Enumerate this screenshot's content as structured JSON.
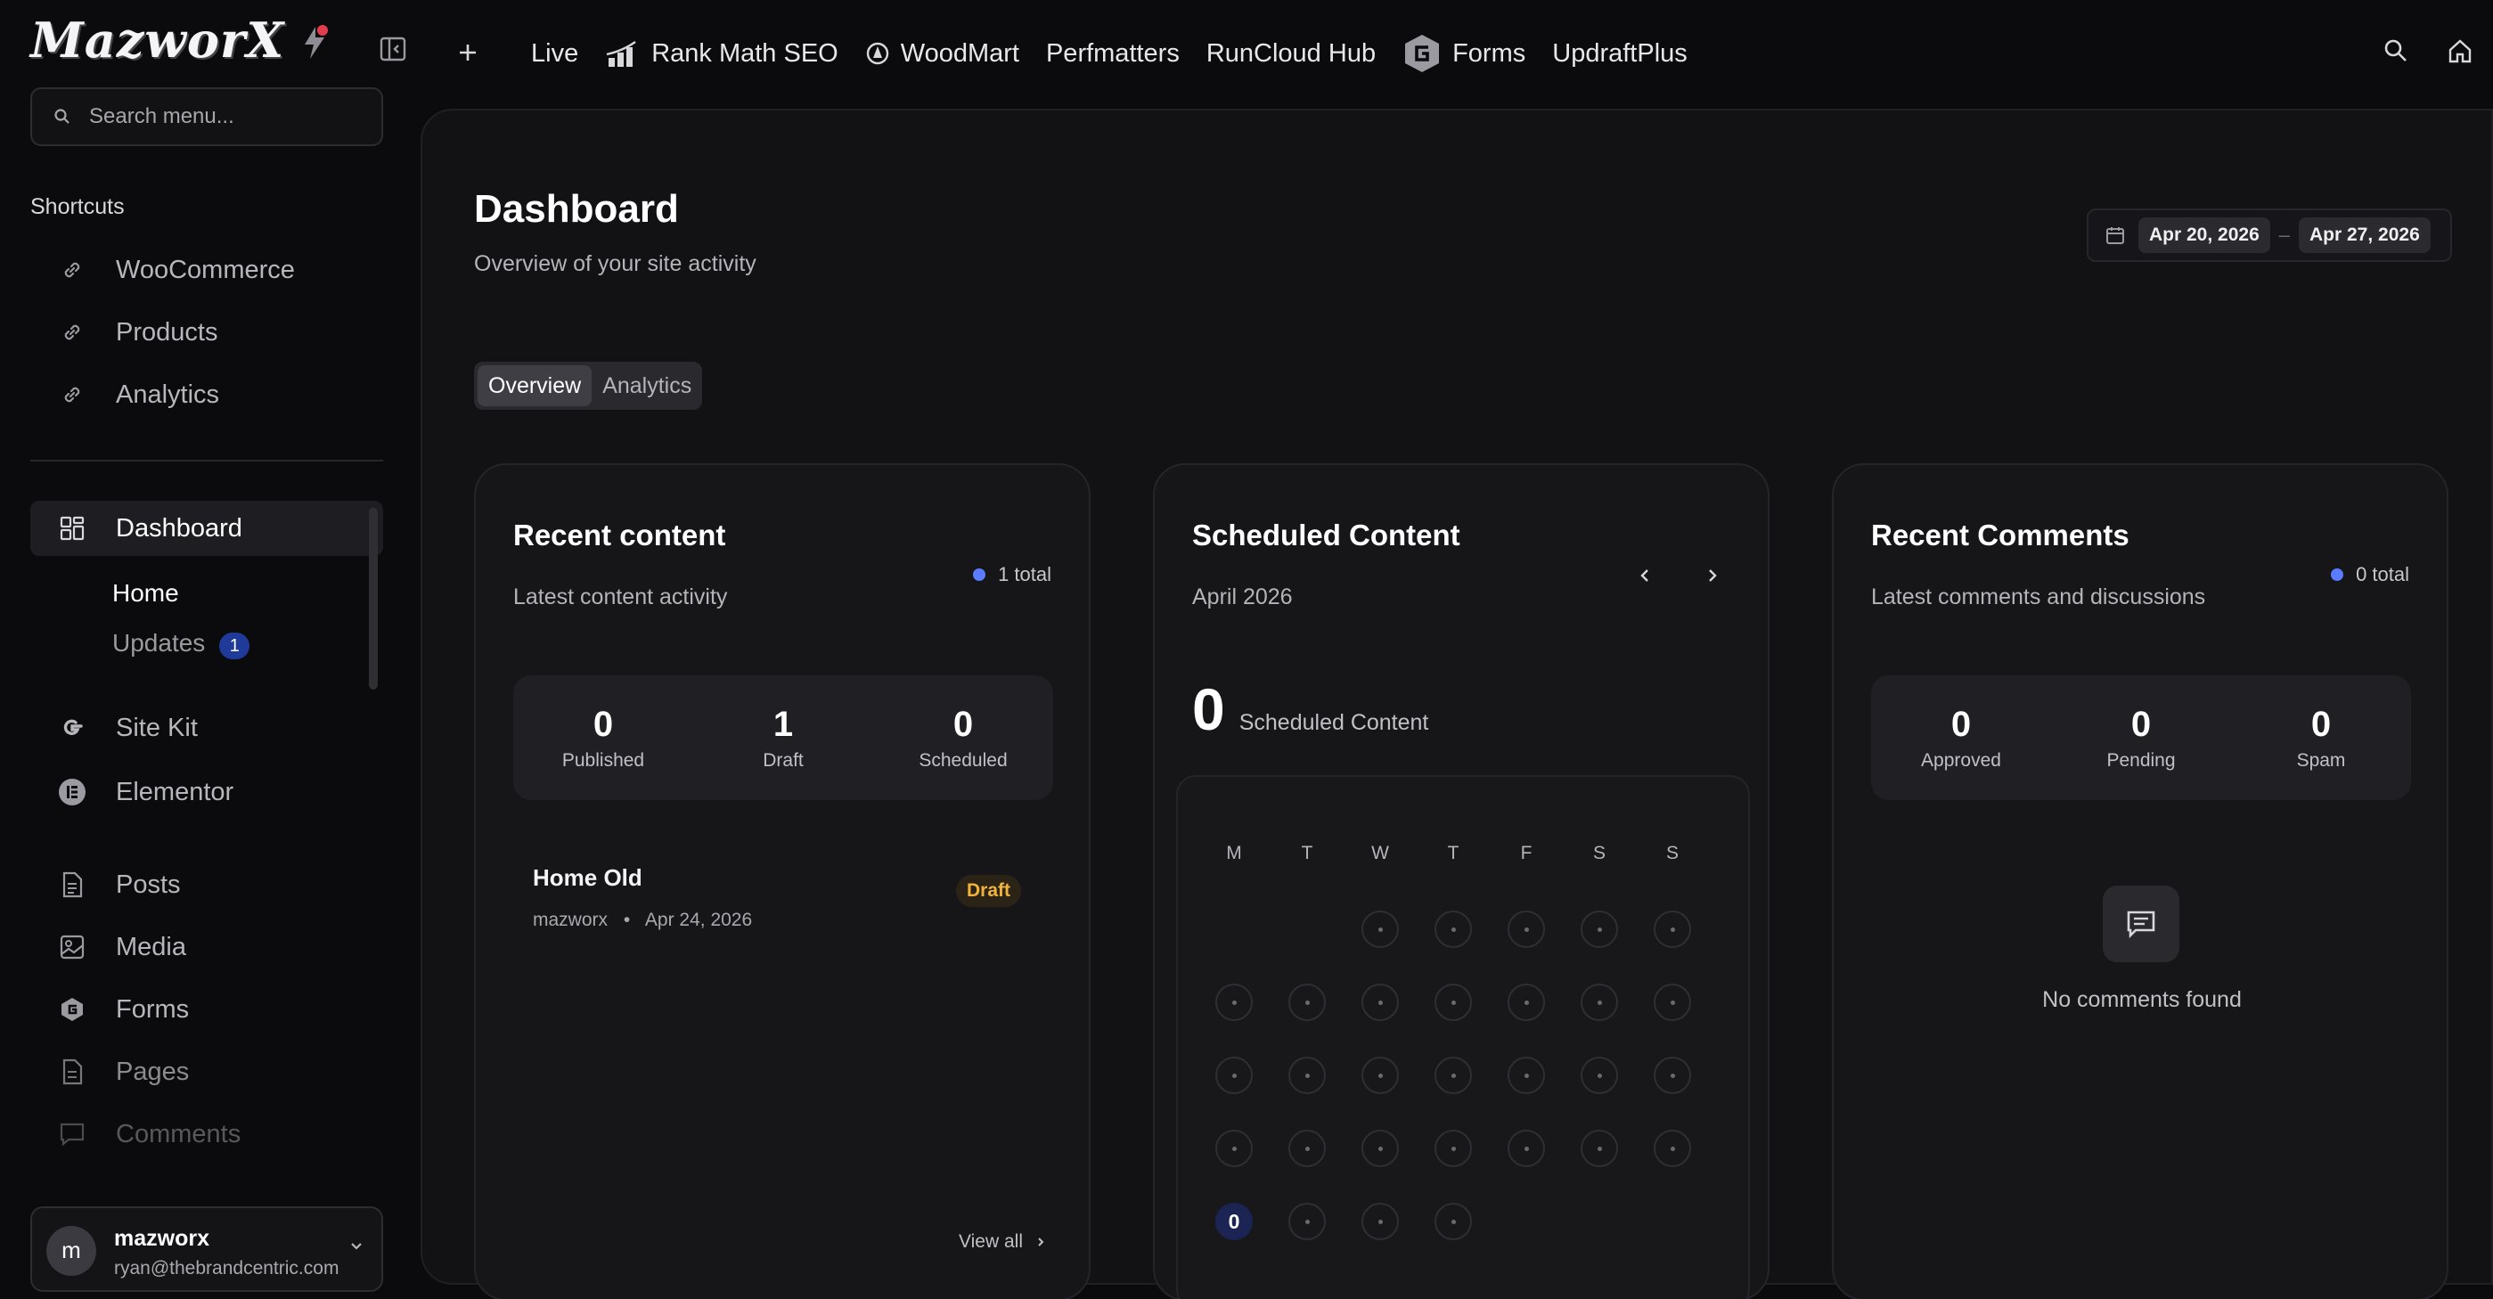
{
  "brand": {
    "logo_text": "MazworX"
  },
  "search": {
    "placeholder": "Search menu..."
  },
  "shortcuts": {
    "title": "Shortcuts",
    "items": [
      {
        "label": "WooCommerce",
        "icon": "link-icon"
      },
      {
        "label": "Products",
        "icon": "link-icon"
      },
      {
        "label": "Analytics",
        "icon": "link-icon"
      }
    ]
  },
  "sidebar": {
    "dashboard": {
      "label": "Dashboard",
      "icon": "grid-icon"
    },
    "home": "Home",
    "updates": {
      "label": "Updates",
      "count": "1"
    },
    "items": [
      {
        "label": "Site Kit",
        "icon": "google-icon"
      },
      {
        "label": "Elementor",
        "icon": "elementor-icon"
      },
      {
        "label": "Posts",
        "icon": "document-icon"
      },
      {
        "label": "Media",
        "icon": "image-icon"
      },
      {
        "label": "Forms",
        "icon": "forms-icon"
      },
      {
        "label": "Pages",
        "icon": "page-icon"
      },
      {
        "label": "Comments",
        "icon": "comment-icon"
      }
    ]
  },
  "user": {
    "initial": "m",
    "name": "mazworx",
    "email": "ryan@thebrandcentric.com"
  },
  "topnav": [
    "Live",
    "Rank Math SEO",
    "WoodMart",
    "Perfmatters",
    "RunCloud Hub",
    "Forms",
    "UpdraftPlus"
  ],
  "page": {
    "title": "Dashboard",
    "subtitle": "Overview of your site activity"
  },
  "daterange": {
    "start": "Apr 20, 2026",
    "sep": "–",
    "end": "Apr 27, 2026"
  },
  "tabs": [
    {
      "label": "Overview",
      "active": true
    },
    {
      "label": "Analytics",
      "active": false
    }
  ],
  "recent_content": {
    "title": "Recent content",
    "subtitle": "Latest content activity",
    "total": "1 total",
    "stats": [
      {
        "value": "0",
        "label": "Published"
      },
      {
        "value": "1",
        "label": "Draft"
      },
      {
        "value": "0",
        "label": "Scheduled"
      }
    ],
    "item": {
      "title": "Home Old",
      "author": "mazworx",
      "sep": "•",
      "date": "Apr 24, 2026",
      "status": "Draft"
    },
    "view_all": "View all"
  },
  "scheduled": {
    "title": "Scheduled Content",
    "month": "April 2026",
    "count": "0",
    "count_label": "Scheduled Content",
    "weekdays": [
      "M",
      "T",
      "W",
      "T",
      "F",
      "S",
      "S"
    ],
    "first_weekday": 2,
    "days_in_month": 30,
    "today_day": 27,
    "today_value": "0"
  },
  "comments": {
    "title": "Recent Comments",
    "subtitle": "Latest comments and discussions",
    "total": "0 total",
    "stats": [
      {
        "value": "0",
        "label": "Approved"
      },
      {
        "value": "0",
        "label": "Pending"
      },
      {
        "value": "0",
        "label": "Spam"
      }
    ],
    "empty": "No comments found"
  },
  "colors": {
    "accent": "#5b7cff",
    "draft": "#f2b33d",
    "badge": "#1f3a99"
  }
}
